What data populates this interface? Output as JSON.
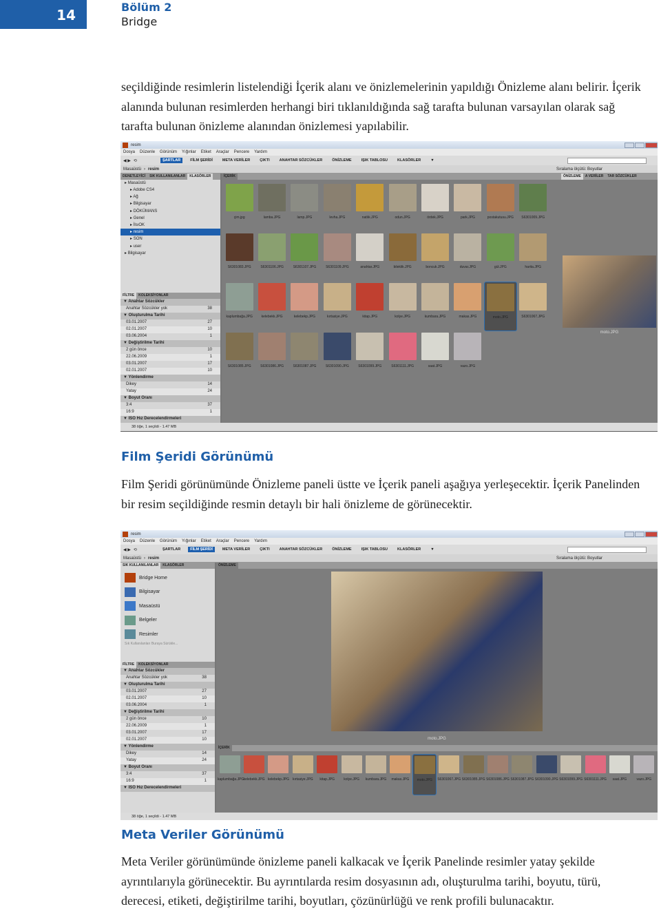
{
  "page": {
    "number": "14",
    "chapter": "Bölüm 2",
    "chapter_title": "Bridge"
  },
  "text": {
    "p1": "seçildiğinde resimlerin listelendiği İçerik alanı ve önizlemelerinin yapıldığı Önizleme alanı belirir. İçerik alanında bulunan resimlerden herhangi biri tıklanıldığında sağ tarafta bulunan varsayılan olarak sağ tarafta bulunan önizleme alanından önizlemesi yapılabilir.",
    "h_film": "Film Şeridi Görünümü",
    "p2": "Film Şeridi görünümünde Önizleme paneli üstte ve İçerik paneli aşağıya yerleşecektir. İçerik Panelinden bir resim seçildiğinde resmin detaylı bir hali önizleme de görünecektir.",
    "h_meta": "Meta Veriler Görünümü",
    "p3": "Meta Veriler görünümünde önizleme paneli kalkacak ve İçerik Panelinde resimler yatay şekilde ayrıntılarıyla görünecektir. Bu ayrıntılarda resim dosyasının adı, oluşturulma tarihi, boyutu, türü, derecesi, etiketi, değiştirilme tarihi, boyutları, çözünürlüğü ve renk profili bulunacaktır."
  },
  "app": {
    "title": "resim",
    "menu": [
      "Dosya",
      "Düzenle",
      "Görünüm",
      "Yığınlar",
      "Etiket",
      "Araçlar",
      "Pencere",
      "Yardım"
    ],
    "workspaces": [
      "ŞARTLAR",
      "FİLM ŞERİDİ",
      "META VERİLER",
      "ÇIKTI",
      "ANAHTAR SÖZCÜKLER",
      "ÖNİZLEME",
      "IŞIK TABLOSU",
      "KLASÖRLER"
    ],
    "path": [
      "Masaüstü",
      "resim"
    ],
    "sort": "Sıralama ölçütü: Boyutlar",
    "status": "38 öğe, 1 seçildi - 1.47 MB",
    "content_tab": "İÇERİK",
    "preview_tab": "ÖNİZLEME",
    "preview_caption": "moto.JPG",
    "left_tabs1": [
      "DENETLEYİCİ",
      "SIK KULLANILANLAR",
      "KLASÖRLER"
    ],
    "right_tabs": [
      "ÖNİZLEME",
      "A VERİLER",
      "TAR SÖZCÜKLER"
    ],
    "left_tabs2": [
      "SIK KULLANILANLAR",
      "KLASÖRLER"
    ],
    "filter_tabs": [
      "FİLTRE",
      "KOLEKSİYONLAR"
    ],
    "tree": [
      "Masaüstü",
      "Adobe CS4",
      "Ağ",
      "Bilgisayar",
      "DÖKÜMANS",
      "Genel",
      "İlsıOK",
      "resim",
      "SON",
      "user",
      "Bilgisayar"
    ],
    "favorites": [
      "Bridge Home",
      "Bilgisayar",
      "Masaüstü",
      "Belgeler",
      "Resimler"
    ],
    "favorites_hint": "Sık Kullanılanları Buraya Sürükle...",
    "filters": [
      {
        "h": "Anahtar Sözcükler",
        "rows": [
          [
            "Anahtar Sözcükler yok",
            "38"
          ]
        ]
      },
      {
        "h": "Oluşturulma Tarihi",
        "rows": [
          [
            "03.01.2007",
            "27"
          ],
          [
            "02.01.2007",
            "10"
          ],
          [
            "03.06.2004",
            "1"
          ]
        ]
      },
      {
        "h": "Değiştirilme Tarihi",
        "rows": [
          [
            "2 gün önce",
            "10"
          ],
          [
            "22.06.2009",
            "1"
          ],
          [
            "03.01.2007",
            "17"
          ],
          [
            "02.01.2007",
            "10"
          ]
        ]
      },
      {
        "h": "Yönlendirme",
        "rows": [
          [
            "Dikey",
            "14"
          ],
          [
            "Yatay",
            "24"
          ]
        ]
      },
      {
        "h": "Boyut Oranı",
        "rows": [
          [
            "3:4",
            "37"
          ],
          [
            "16:9",
            "1"
          ]
        ]
      },
      {
        "h": "ISO Hız Derecelendirmeleri",
        "rows": []
      }
    ],
    "files": [
      {
        "n": "çim.jpg",
        "c": "#7fa34a"
      },
      {
        "n": "lamba.JPG",
        "c": "#6f6f60"
      },
      {
        "n": "lamp.JPG",
        "c": "#8b8c84"
      },
      {
        "n": "levha.JPG",
        "c": "#8a8070"
      },
      {
        "n": "natlık.JPG",
        "c": "#c49a3b"
      },
      {
        "n": "odun.JPG",
        "c": "#a89e88"
      },
      {
        "n": "ördek.JPG",
        "c": "#d8d2c8"
      },
      {
        "n": "park.JPG",
        "c": "#c9b9a3"
      },
      {
        "n": "postakutusu.JPG",
        "c": "#b07a52"
      },
      {
        "n": "S6301009.JPG",
        "c": "#5f7e4c"
      },
      {
        "n": "S6301083.JPG",
        "c": "#5a3a2a"
      },
      {
        "n": "S6301106.JPG",
        "c": "#8aa070"
      },
      {
        "n": "S6301107.JPG",
        "c": "#6a9848"
      },
      {
        "n": "S6301109.JPG",
        "c": "#a88a80"
      },
      {
        "n": "anahtar.JPG",
        "c": "#d4d0c8"
      },
      {
        "n": "bileklik.JPG",
        "c": "#8a6a3a"
      },
      {
        "n": "boncuk.JPG",
        "c": "#c4a46a"
      },
      {
        "n": "duvar.JPG",
        "c": "#bab2a2"
      },
      {
        "n": "gül.JPG",
        "c": "#6e9a50"
      },
      {
        "n": "harita.JPG",
        "c": "#b29a72"
      },
      {
        "n": "kaplumbağa.JPG",
        "c": "#8e9e94"
      },
      {
        "n": "kelebekk.JPG",
        "c": "#c8503e"
      },
      {
        "n": "kelebekp.JPG",
        "c": "#d49a86"
      },
      {
        "n": "kırtasiye.JPG",
        "c": "#c8b088"
      },
      {
        "n": "kitap.JPG",
        "c": "#c04030"
      },
      {
        "n": "kolye.JPG",
        "c": "#c8b8a0"
      },
      {
        "n": "kumbara.JPG",
        "c": "#c4b49a"
      },
      {
        "n": "makas.JPG",
        "c": "#d8a070"
      },
      {
        "n": "moto.JPG",
        "c": "#8a7040",
        "sel": true
      },
      {
        "n": "S6301067.JPG",
        "c": "#cfb58a"
      },
      {
        "n": "S6301085.JPG",
        "c": "#807050"
      },
      {
        "n": "S6301086.JPG",
        "c": "#a08070"
      },
      {
        "n": "S6301087.JPG",
        "c": "#8e8670"
      },
      {
        "n": "S6301090.JPG",
        "c": "#3a4a6a"
      },
      {
        "n": "S6301099.JPG",
        "c": "#c8c0b0"
      },
      {
        "n": "S6301111.JPG",
        "c": "#e06a80"
      },
      {
        "n": "saat.JPG",
        "c": "#d8d8d0"
      },
      {
        "n": "vazo.JPG",
        "c": "#b8b4b8"
      }
    ]
  }
}
